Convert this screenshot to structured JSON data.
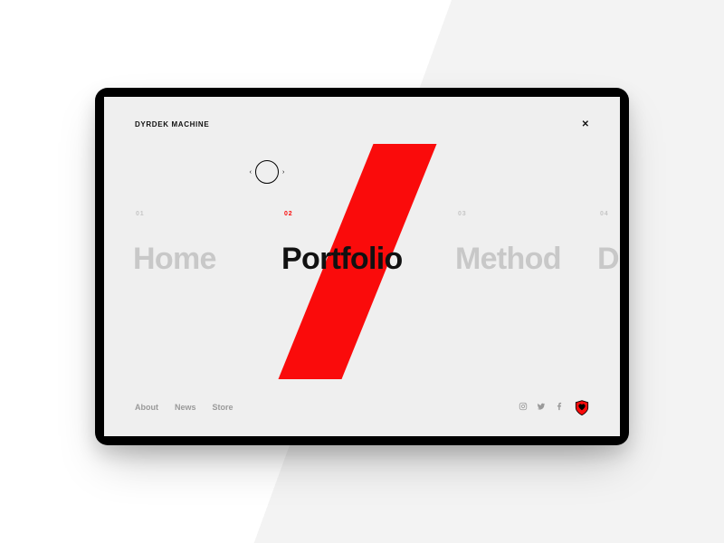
{
  "header": {
    "logo": "DYRDEK MACHINE",
    "close_icon": "✕"
  },
  "nav_bubble": {
    "left": "‹",
    "right": "›"
  },
  "nav": {
    "items": [
      {
        "num": "01",
        "label": "Home"
      },
      {
        "num": "02",
        "label": "Portfolio"
      },
      {
        "num": "03",
        "label": "Method"
      },
      {
        "num": "04",
        "label": "Do"
      }
    ],
    "active_index": 1
  },
  "footer": {
    "links": [
      "About",
      "News",
      "Store"
    ],
    "social": [
      "instagram",
      "twitter",
      "facebook"
    ]
  }
}
